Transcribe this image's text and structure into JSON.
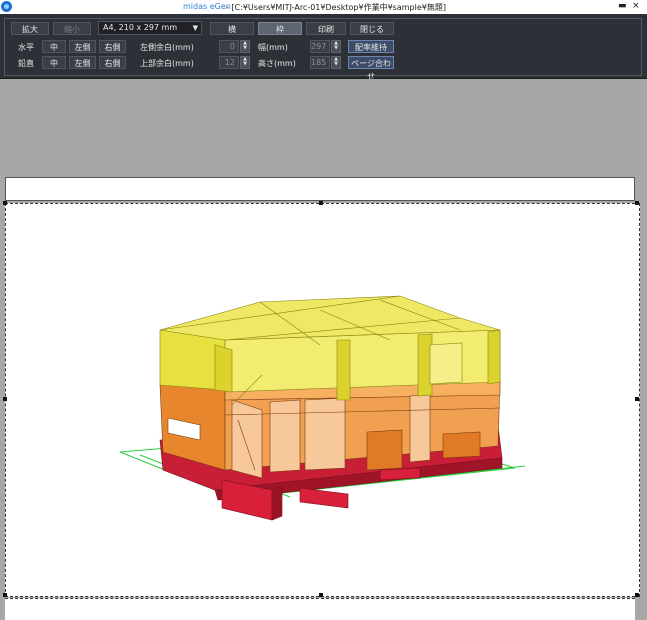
{
  "titlebar": {
    "app_name": "midas eGen",
    "path": "- [C:¥Users¥MITJ-Arc-01¥Desktop¥作業中¥sample¥無題]",
    "close": "×"
  },
  "toolbar": {
    "zoom_in": "拡大",
    "zoom_out": "縮小",
    "paper_size": "A4, 210 x 297 mm",
    "orientation_landscape": "横",
    "frame": "枠",
    "print": "印刷",
    "close": "閉じる",
    "horizontal_label": "水平",
    "vertical_label": "鉛直",
    "center": "中",
    "left": "左側",
    "right": "右側",
    "left_margin_label": "左側余白(mm)",
    "top_margin_label": "上部余白(mm)",
    "left_margin_value": "0",
    "top_margin_value": "12",
    "width_label": "幅(mm)",
    "height_label": "高さ(mm)",
    "width_value": "297",
    "height_value": "185",
    "keep_ratio": "配率維持",
    "fit_page": "ページ合わせ"
  },
  "colors": {
    "toolbar_bg": "#2d3036",
    "roof_yellow": "#e6e040",
    "wall_orange": "#e8862e",
    "base_red": "#d8203a",
    "grid_green": "#2ecc40"
  }
}
